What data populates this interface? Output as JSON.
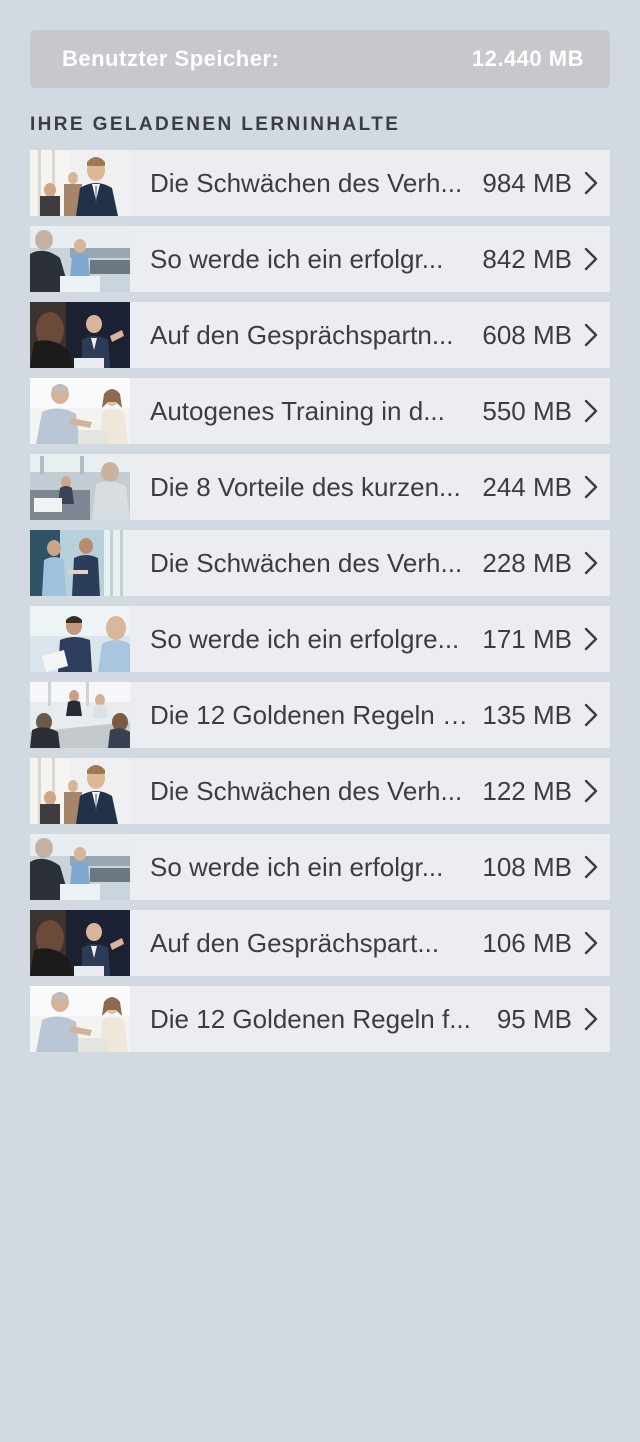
{
  "storage": {
    "label": "Benutzter Speicher:",
    "value": "12.440 MB"
  },
  "section_title": "IHRE GELADENEN LERNINHALTE",
  "items": [
    {
      "title": "Die Schwächen des Verh...",
      "size": "984 MB",
      "thumb": "man-suit-office"
    },
    {
      "title": "So werde ich ein erfolgr...",
      "size": "842 MB",
      "thumb": "meeting-open-office"
    },
    {
      "title": "Auf den Gesprächspartn...",
      "size": "608 MB",
      "thumb": "talk-dark"
    },
    {
      "title": "Autogenes Training in d...",
      "size": "550 MB",
      "thumb": "man-woman-talk"
    },
    {
      "title": "Die 8 Vorteile des kurzen...",
      "size": "244 MB",
      "thumb": "office-group"
    },
    {
      "title": "Die Schwächen des Verh...",
      "size": "228 MB",
      "thumb": "two-men-window"
    },
    {
      "title": "So werde ich ein erfolgre...",
      "size": "171 MB",
      "thumb": "men-tablet"
    },
    {
      "title": "Die 12 Goldenen Regeln f...",
      "size": "135 MB",
      "thumb": "conference-table"
    },
    {
      "title": "Die Schwächen des Verh...",
      "size": "122 MB",
      "thumb": "man-suit-office"
    },
    {
      "title": "So werde ich ein erfolgr...",
      "size": "108 MB",
      "thumb": "meeting-open-office"
    },
    {
      "title": "Auf den Gesprächspart...",
      "size": "106 MB",
      "thumb": "talk-dark"
    },
    {
      "title": "Die 12 Goldenen Regeln f...",
      "size": "95 MB",
      "thumb": "man-woman-talk"
    }
  ],
  "icons": {
    "chevron": "chevron-right-icon"
  },
  "colors": {
    "background": "#d3d9e1",
    "row": "#ebedf0",
    "storage_bar": "#c6c8cb",
    "text": "#3a3d45"
  }
}
